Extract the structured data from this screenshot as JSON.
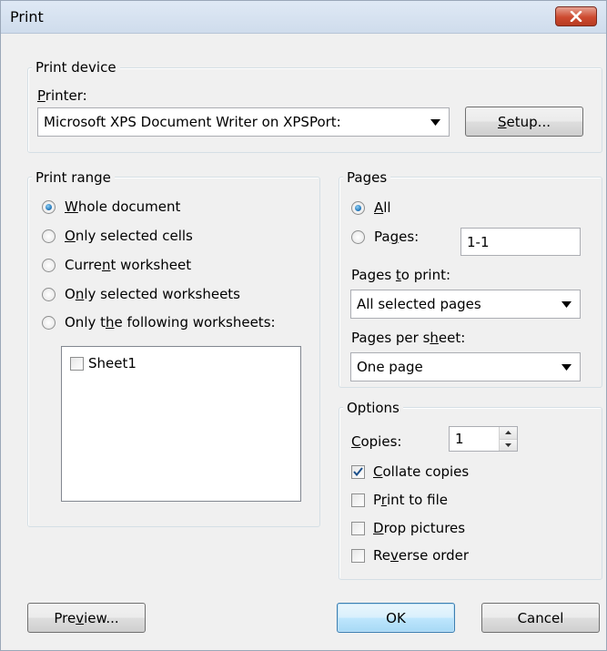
{
  "window": {
    "title": "Print"
  },
  "print_device": {
    "group_label": "Print device",
    "printer_label": "Printer:",
    "printer_value": "Microsoft XPS Document Writer on XPSPort:",
    "setup_button": "Setup..."
  },
  "print_range": {
    "group_label": "Print range",
    "options": [
      {
        "label": "Whole document",
        "checked": true
      },
      {
        "label": "Only selected cells",
        "checked": false
      },
      {
        "label": "Current worksheet",
        "checked": false
      },
      {
        "label": "Only selected worksheets",
        "checked": false
      },
      {
        "label": "Only the following worksheets:",
        "checked": false
      }
    ],
    "worksheets": [
      {
        "label": "Sheet1",
        "checked": false
      }
    ]
  },
  "pages": {
    "group_label": "Pages",
    "all_label": "All",
    "pages_label": "Pages:",
    "pages_value": "1-1",
    "pages_to_print_label": "Pages to print:",
    "pages_to_print_value": "All selected pages",
    "pages_per_sheet_label": "Pages per sheet:",
    "pages_per_sheet_value": "One page"
  },
  "options": {
    "group_label": "Options",
    "copies_label": "Copies:",
    "copies_value": "1",
    "checkboxes": [
      {
        "label": "Collate copies",
        "checked": true
      },
      {
        "label": "Print to file",
        "checked": false
      },
      {
        "label": "Drop pictures",
        "checked": false
      },
      {
        "label": "Reverse order",
        "checked": false
      }
    ]
  },
  "footer": {
    "preview_button": "Preview...",
    "ok_button": "OK",
    "cancel_button": "Cancel"
  },
  "icons": {
    "close": "close-icon",
    "dropdown": "chevron-down-icon",
    "check": "check-icon",
    "spin_up": "spin-up-icon",
    "spin_down": "spin-down-icon"
  },
  "colors": {
    "close_button": "#cd4a30",
    "radio_dot": "#1b6fb4",
    "default_button_border": "#3c7fb1",
    "dialog_bg": "#f0f0f0"
  }
}
